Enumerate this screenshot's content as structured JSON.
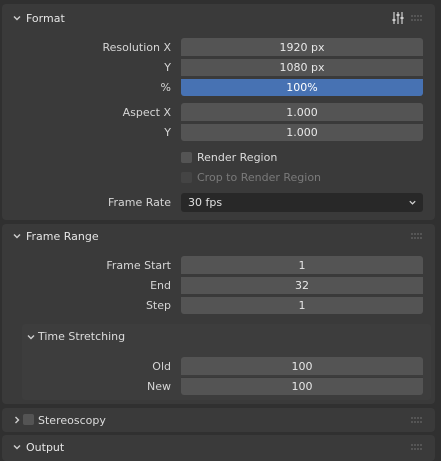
{
  "format": {
    "title": "Format",
    "presets_icon": "preset-sliders-icon",
    "resolution_x_label": "Resolution X",
    "resolution_x": "1920 px",
    "resolution_y_label": "Y",
    "resolution_y": "1080 px",
    "percent_label": "%",
    "percent_value": "100%",
    "percent_fill": 1.0,
    "aspect_x_label": "Aspect X",
    "aspect_x": "1.000",
    "aspect_y_label": "Y",
    "aspect_y": "1.000",
    "render_region_label": "Render Region",
    "crop_label": "Crop to Render Region",
    "frame_rate_label": "Frame Rate",
    "frame_rate_value": "30 fps"
  },
  "frame_range": {
    "title": "Frame Range",
    "start_label": "Frame Start",
    "start_value": "1",
    "end_label": "End",
    "end_value": "32",
    "step_label": "Step",
    "step_value": "1"
  },
  "time_stretching": {
    "title": "Time Stretching",
    "old_label": "Old",
    "old_value": "100",
    "new_label": "New",
    "new_value": "100"
  },
  "stereoscopy": {
    "title": "Stereoscopy"
  },
  "output": {
    "title": "Output"
  },
  "colors": {
    "accent": "#4772b3",
    "field": "#545454",
    "panel": "#3a3a3a",
    "background": "#303030"
  }
}
